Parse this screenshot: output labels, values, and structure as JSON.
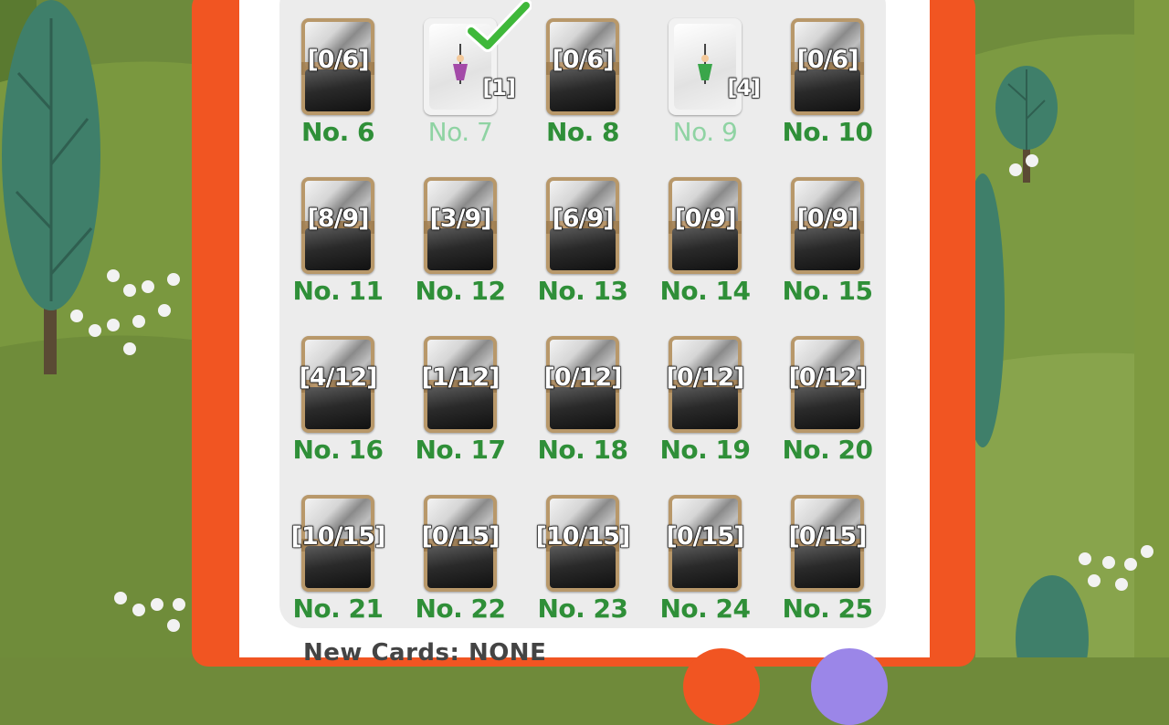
{
  "collection": {
    "cards": [
      {
        "name": "No. 6",
        "count": "[0/6]",
        "collected": false
      },
      {
        "name": "No. 7",
        "count": "[1]",
        "collected": true,
        "figure_color": "#a34aa8",
        "checked": true
      },
      {
        "name": "No. 8",
        "count": "[0/6]",
        "collected": false
      },
      {
        "name": "No. 9",
        "count": "[4]",
        "collected": true,
        "figure_color": "#3aa64a",
        "checked": false
      },
      {
        "name": "No. 10",
        "count": "[0/6]",
        "collected": false
      },
      {
        "name": "No. 11",
        "count": "[8/9]",
        "collected": false
      },
      {
        "name": "No. 12",
        "count": "[3/9]",
        "collected": false
      },
      {
        "name": "No. 13",
        "count": "[6/9]",
        "collected": false
      },
      {
        "name": "No. 14",
        "count": "[0/9]",
        "collected": false
      },
      {
        "name": "No. 15",
        "count": "[0/9]",
        "collected": false
      },
      {
        "name": "No. 16",
        "count": "[4/12]",
        "collected": false
      },
      {
        "name": "No. 17",
        "count": "[1/12]",
        "collected": false
      },
      {
        "name": "No. 18",
        "count": "[0/12]",
        "collected": false
      },
      {
        "name": "No. 19",
        "count": "[0/12]",
        "collected": false
      },
      {
        "name": "No. 20",
        "count": "[0/12]",
        "collected": false
      },
      {
        "name": "No. 21",
        "count": "[10/15]",
        "collected": false
      },
      {
        "name": "No. 22",
        "count": "[0/15]",
        "collected": false
      },
      {
        "name": "No. 23",
        "count": "[10/15]",
        "collected": false
      },
      {
        "name": "No. 24",
        "count": "[0/15]",
        "collected": false
      },
      {
        "name": "No. 25",
        "count": "[0/15]",
        "collected": false
      }
    ]
  },
  "footer": {
    "new_cards_text": "New Cards: NONE"
  },
  "icons": {
    "checkmark": "checkmark-icon",
    "card_figure": "figure-icon"
  },
  "colors": {
    "frame": "#f15522",
    "panel": "#ececec",
    "name_green": "#2f8f38",
    "name_done": "#8fd3a3",
    "check_green": "#3fb83a"
  }
}
